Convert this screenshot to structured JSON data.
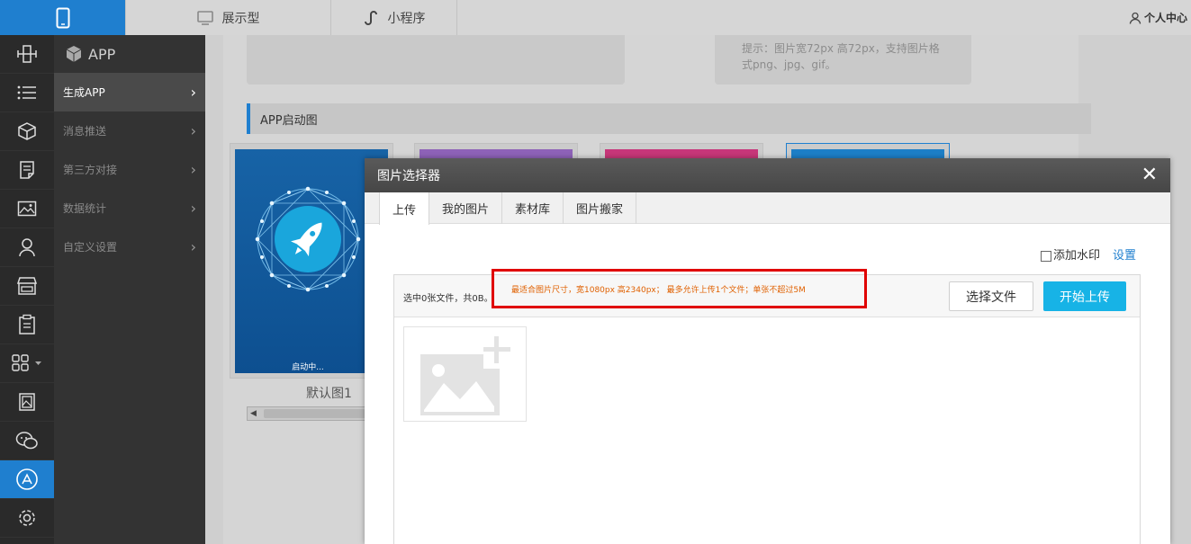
{
  "topbar": {
    "tabs": [
      {
        "label": "展示型",
        "icon": "monitor-icon"
      },
      {
        "label": "小程序",
        "icon": "miniprogram-icon"
      }
    ],
    "user_label": "个人中心"
  },
  "rail": {
    "icons": [
      "plugin-icon",
      "list-icon",
      "cube-icon",
      "document-icon",
      "image-icon",
      "user-icon",
      "store-icon",
      "clipboard-icon",
      "grid-icon",
      "picture-frame-icon",
      "wechat-icon",
      "app-store-icon",
      "settings-icon"
    ],
    "active": "app-store-icon"
  },
  "submenu": {
    "title": "APP",
    "items": [
      {
        "label": "生成APP",
        "active": true
      },
      {
        "label": "消息推送",
        "active": false
      },
      {
        "label": "第三方对接",
        "active": false
      },
      {
        "label": "数据统计",
        "active": false
      },
      {
        "label": "自定义设置",
        "active": false
      }
    ]
  },
  "content": {
    "icon_tip_line1": "提示：图片宽72px 高72px，支持图片格",
    "icon_tip_line2": "式png、jpg、gif。",
    "section_title": "APP启动图",
    "launch_text": "启动中...",
    "default_caption": "默认图1"
  },
  "modal": {
    "title": "图片选择器",
    "tabs": [
      "上传",
      "我的图片",
      "素材库",
      "图片搬家"
    ],
    "active_tab": "上传",
    "watermark_label": "添加水印",
    "settings_link": "设置",
    "count_text": "选中0张文件，共0B。",
    "hint_text": "最适合图片尺寸，宽1080px 高2340px； 最多允许上传1个文件；单张不超过5M",
    "select_button": "选择文件",
    "upload_button": "开始上传"
  },
  "colors": {
    "accent_blue": "#1f7fcf",
    "upload_button": "#17b3e6",
    "highlight_red": "#e00000",
    "hint_orange": "#e06000"
  }
}
